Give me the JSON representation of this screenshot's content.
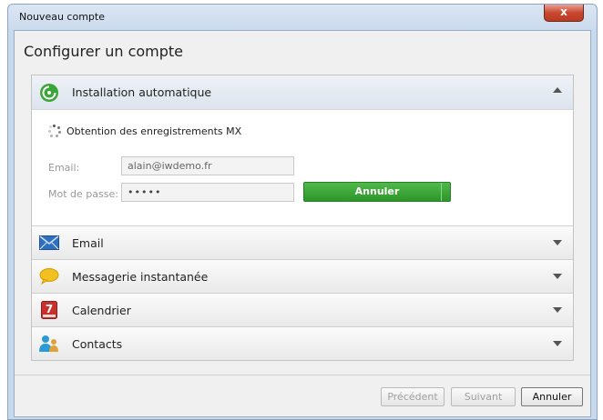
{
  "window": {
    "title": "Nouveau compte",
    "close_glyph": "x"
  },
  "heading": "Configurer un compte",
  "sections": [
    {
      "label": "Installation automatique",
      "icon": "auto-install-icon",
      "expanded": true
    },
    {
      "label": "Email",
      "icon": "envelope-icon",
      "expanded": false
    },
    {
      "label": "Messagerie instantanée",
      "icon": "chat-bubble-icon",
      "expanded": false
    },
    {
      "label": "Calendrier",
      "icon": "calendar-icon",
      "expanded": false
    },
    {
      "label": "Contacts",
      "icon": "contacts-icon",
      "expanded": false
    }
  ],
  "auto_install": {
    "status": "Obtention des enregistrements MX",
    "email_label": "Email:",
    "email_value": "alain@iwdemo.fr",
    "password_label": "Mot de passe:",
    "password_value": "•••••",
    "cancel_label": "Annuler"
  },
  "calendar_icon_text": "7",
  "footer": {
    "previous_label": "Précédent",
    "next_label": "Suivant",
    "cancel_label": "Annuler"
  },
  "colors": {
    "accent_green": "#2d962a",
    "envelope_blue": "#2f6fbf",
    "chat_yellow": "#f2c01f",
    "calendar_red": "#c8302c",
    "contacts_blue": "#2b9bd8"
  }
}
